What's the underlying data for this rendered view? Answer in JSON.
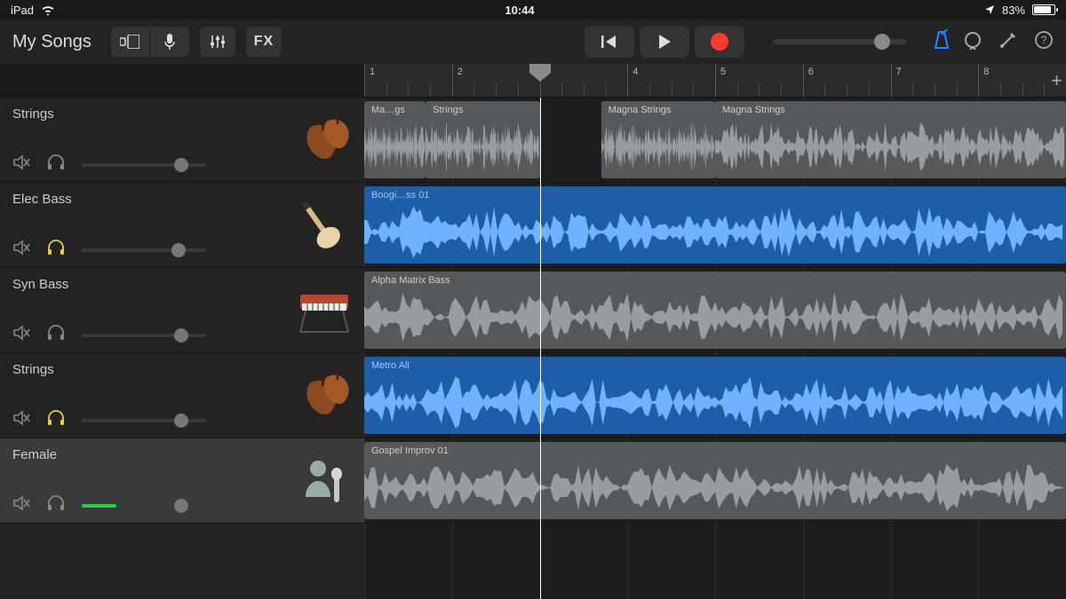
{
  "status": {
    "device": "iPad",
    "time": "10:44",
    "battery_pct": "83%"
  },
  "toolbar": {
    "title": "My Songs",
    "fx": "FX"
  },
  "ruler": {
    "bars": [
      "1",
      "2",
      "3",
      "4",
      "5",
      "6",
      "7",
      "8"
    ],
    "playhead_bar": 3
  },
  "tracks": [
    {
      "name": "Strings",
      "solo": false,
      "selected": false,
      "instrument": "strings",
      "volume": 0.8,
      "level": 0
    },
    {
      "name": "Elec Bass",
      "solo": true,
      "selected": false,
      "instrument": "bass-guitar",
      "volume": 0.78,
      "level": 0
    },
    {
      "name": "Syn Bass",
      "solo": false,
      "selected": false,
      "instrument": "synth",
      "volume": 0.8,
      "level": 0
    },
    {
      "name": "Strings",
      "solo": true,
      "selected": false,
      "instrument": "strings",
      "volume": 0.8,
      "level": 0
    },
    {
      "name": "Female",
      "solo": false,
      "selected": true,
      "instrument": "vocals",
      "volume": 0.8,
      "level": 0.28
    }
  ],
  "regions": {
    "0": [
      {
        "label": "Ma…gs",
        "start": 1.0,
        "end": 1.7,
        "color": "gray"
      },
      {
        "label": "Strings",
        "start": 1.7,
        "end": 3.0,
        "color": "gray"
      },
      {
        "label": "Magna Strings",
        "start": 3.7,
        "end": 5.0,
        "color": "gray"
      },
      {
        "label": "Magna Strings",
        "start": 5.0,
        "end": 9.0,
        "color": "gray"
      }
    ],
    "1": [
      {
        "label": "Boogi…ss 01",
        "start": 1.0,
        "end": 9.0,
        "color": "blue"
      }
    ],
    "2": [
      {
        "label": "Alpha Matrix Bass",
        "start": 1.0,
        "end": 9.0,
        "color": "gray"
      }
    ],
    "3": [
      {
        "label": "Metro All",
        "start": 1.0,
        "end": 9.0,
        "color": "blue"
      }
    ],
    "4": [
      {
        "label": "Gospel Improv 01",
        "start": 1.0,
        "end": 9.0,
        "color": "gray"
      }
    ]
  },
  "colors": {
    "accent": "#2a84ff",
    "record": "#ff3b30",
    "solo": "#f7c846",
    "region_blue": "#1c5fa8",
    "region_gray": "#56595c"
  }
}
